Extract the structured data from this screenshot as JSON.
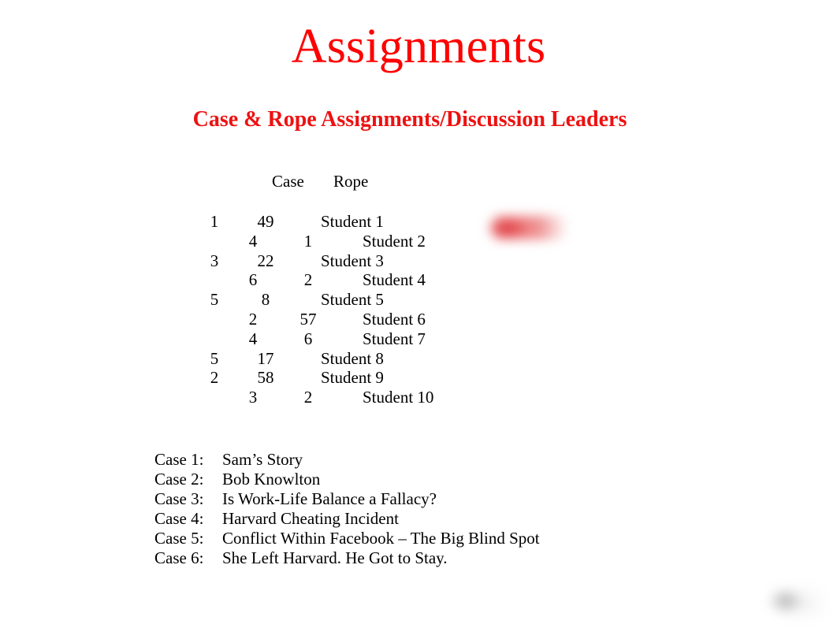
{
  "slide": {
    "title": "Assignments",
    "subtitle": "Case & Rope Assignments/Discussion Leaders",
    "title_color": "#ff0000",
    "background_color": "#ffffff"
  },
  "table": {
    "headers": {
      "case": "Case",
      "rope": "Rope"
    },
    "rows": [
      {
        "style": "a",
        "num": "1",
        "case": "49",
        "rope": "",
        "name": "Student 1"
      },
      {
        "style": "b",
        "num": "",
        "case": "4",
        "rope": "1",
        "name": "Student 2"
      },
      {
        "style": "a",
        "num": "3",
        "case": "22",
        "rope": "",
        "name": "Student 3"
      },
      {
        "style": "b",
        "num": "",
        "case": "6",
        "rope": "2",
        "name": "Student 4"
      },
      {
        "style": "a",
        "num": "5",
        "case": "8",
        "rope": "",
        "name": "Student 5"
      },
      {
        "style": "b",
        "num": "",
        "case": "2",
        "rope": "57",
        "name": "Student 6"
      },
      {
        "style": "b",
        "num": "",
        "case": "4",
        "rope": "6",
        "name": "Student 7"
      },
      {
        "style": "a",
        "num": "5",
        "case": "17",
        "rope": "",
        "name": "Student 8"
      },
      {
        "style": "a",
        "num": "2",
        "case": "58",
        "rope": "",
        "name": "Student 9"
      },
      {
        "style": "b",
        "num": "",
        "case": "3",
        "rope": "2",
        "name": "Student 10"
      }
    ]
  },
  "case_list": [
    {
      "label": "Case 1:",
      "name": "Sam’s Story"
    },
    {
      "label": "Case 2:",
      "name": "Bob Knowlton"
    },
    {
      "label": "Case 3:",
      "name": "Is Work-Life Balance a Fallacy?"
    },
    {
      "label": "Case 4:",
      "name": "Harvard Cheating Incident"
    },
    {
      "label": "Case 5:",
      "name": "Conflict Within Facebook – The Big Blind Spot"
    },
    {
      "label": "Case 6:",
      "name": "She Left Harvard. He Got to Stay."
    }
  ],
  "overlays": {
    "redaction": {
      "name": "blurred-red-annotation",
      "color": "#e2444a"
    },
    "corner": {
      "name": "blurred-corner-control",
      "color": "#9a9a9c"
    }
  }
}
